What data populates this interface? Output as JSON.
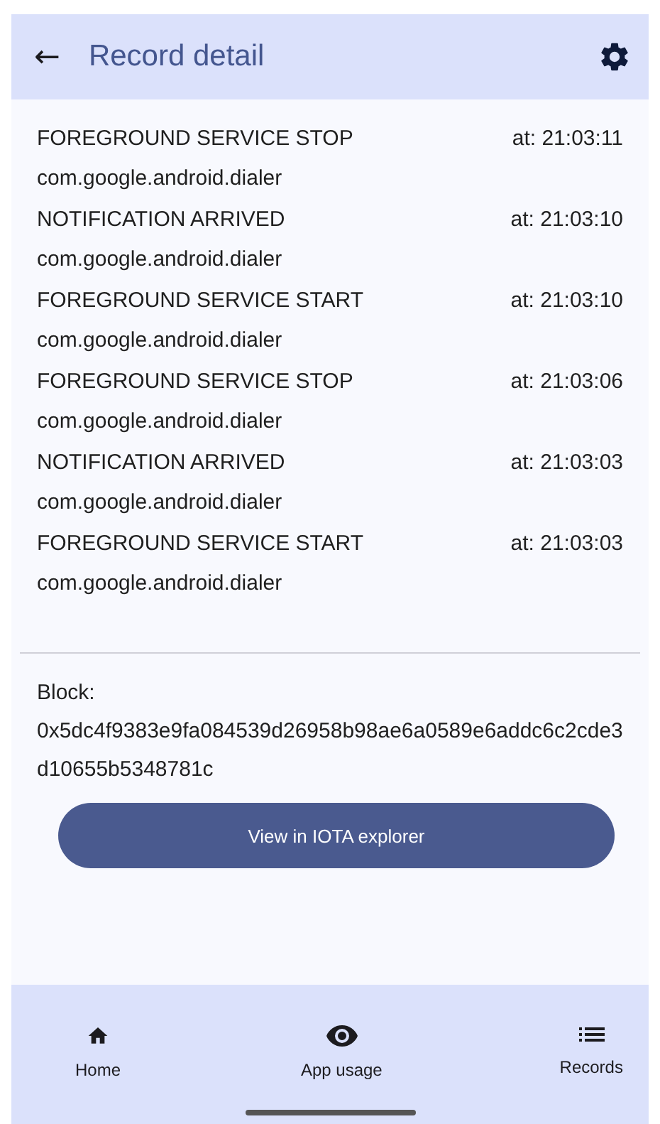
{
  "app_bar": {
    "back": "←",
    "title": "Record detail"
  },
  "records": [
    {
      "event": "FOREGROUND SERVICE STOP",
      "time": "at: 21:03:11",
      "package": "com.google.android.dialer"
    },
    {
      "event": "NOTIFICATION ARRIVED",
      "time": "at: 21:03:10",
      "package": "com.google.android.dialer"
    },
    {
      "event": "FOREGROUND SERVICE START",
      "time": "at: 21:03:10",
      "package": "com.google.android.dialer"
    },
    {
      "event": "FOREGROUND SERVICE STOP",
      "time": "at: 21:03:06",
      "package": "com.google.android.dialer"
    },
    {
      "event": "NOTIFICATION ARRIVED",
      "time": "at: 21:03:03",
      "package": "com.google.android.dialer"
    },
    {
      "event": "FOREGROUND SERVICE START",
      "time": "at: 21:03:03",
      "package": "com.google.android.dialer"
    }
  ],
  "block": {
    "label": "Block:",
    "hash": "0x5dc4f9383e9fa084539d26958b98ae6a0589e6addc6c2cde3d10655b5348781c"
  },
  "button": "View in IOTA explorer",
  "nav": [
    {
      "kind": "home",
      "label": "Home"
    },
    {
      "kind": "eye",
      "label": "App usage"
    },
    {
      "kind": "list",
      "label": "Records"
    }
  ]
}
